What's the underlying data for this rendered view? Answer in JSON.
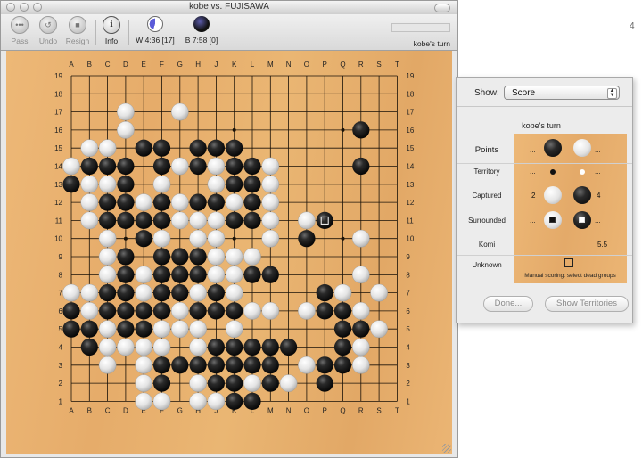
{
  "window": {
    "title": "kobe vs. FUJISAWA"
  },
  "toolbar": {
    "pass": "Pass",
    "undo": "Undo",
    "resign": "Resign",
    "info": "Info",
    "info_glyph": "i",
    "white_clock": "W 4:36 [17]",
    "black_clock": "B 7:58 [0]",
    "turn": "kobe's turn"
  },
  "board": {
    "size": 19,
    "columns": [
      "A",
      "B",
      "C",
      "D",
      "E",
      "F",
      "G",
      "H",
      "J",
      "K",
      "L",
      "M",
      "N",
      "O",
      "P",
      "Q",
      "R",
      "S",
      "T"
    ],
    "rows": [
      "19",
      "18",
      "17",
      "16",
      "15",
      "14",
      "13",
      "12",
      "11",
      "10",
      "9",
      "8",
      "7",
      "6",
      "5",
      "4",
      "3",
      "2",
      "1"
    ],
    "hoshi": [
      "D16",
      "K16",
      "Q16",
      "D10",
      "K10",
      "Q10",
      "D4",
      "K4",
      "Q4"
    ],
    "last_move": "P11",
    "black_stones": [
      "R16",
      "E15",
      "F15",
      "H15",
      "J15",
      "K15",
      "A13",
      "B14",
      "C14",
      "D14",
      "F14",
      "H14",
      "K14",
      "L14",
      "R14",
      "D13",
      "J13",
      "K13",
      "L13",
      "C12",
      "D12",
      "F12",
      "H12",
      "J12",
      "L12",
      "C11",
      "D11",
      "E11",
      "F11",
      "K11",
      "L11",
      "P11",
      "E10",
      "O10",
      "D9",
      "F9",
      "G9",
      "H9",
      "D8",
      "F8",
      "G8",
      "H8",
      "L8",
      "M8",
      "C7",
      "D7",
      "F7",
      "G7",
      "J7",
      "P7",
      "A6",
      "C6",
      "D6",
      "E6",
      "F6",
      "H6",
      "J6",
      "K6",
      "P6",
      "Q6",
      "A5",
      "B5",
      "C5",
      "D5",
      "E5",
      "Q5",
      "R5",
      "B4",
      "J4",
      "K4",
      "L4",
      "M4",
      "N4",
      "Q4",
      "F3",
      "G3",
      "H3",
      "J3",
      "K3",
      "L3",
      "M3",
      "P3",
      "Q3",
      "F2",
      "J2",
      "K2",
      "M2",
      "P2",
      "K1",
      "L1"
    ],
    "white_stones": [
      "D17",
      "G17",
      "D16",
      "B15",
      "C15",
      "A14",
      "G14",
      "J14",
      "M14",
      "B13",
      "C13",
      "F13",
      "J13",
      "M13",
      "B12",
      "E12",
      "G12",
      "K12",
      "M12",
      "B11",
      "G11",
      "H11",
      "J11",
      "M11",
      "O11",
      "C10",
      "F10",
      "H10",
      "J10",
      "M10",
      "R10",
      "C9",
      "J9",
      "K9",
      "L9",
      "C8",
      "E8",
      "J8",
      "K8",
      "R8",
      "A7",
      "B7",
      "E7",
      "H7",
      "K7",
      "Q7",
      "S7",
      "B6",
      "G6",
      "L6",
      "M6",
      "O6",
      "R6",
      "C5",
      "F5",
      "G5",
      "H5",
      "K5",
      "S5",
      "C4",
      "D4",
      "E4",
      "F4",
      "H4",
      "R4",
      "C3",
      "E3",
      "O3",
      "R3",
      "E2",
      "H2",
      "L2",
      "N2",
      "E1",
      "F1",
      "H1",
      "J1"
    ]
  },
  "score_panel": {
    "show_label": "Show:",
    "show_value": "Score",
    "turn": "kobe's turn",
    "points_label": "Points",
    "points_black": "...",
    "points_white": "...",
    "territory_label": "Territory",
    "territory_black": "...",
    "territory_white": "...",
    "captured_label": "Captured",
    "captured_white": "2",
    "captured_black": "4",
    "surrounded_label": "Surrounded",
    "surrounded_black": "...",
    "surrounded_white": "...",
    "komi_label": "Komi",
    "komi_value": "5.5",
    "unknown_label": "Unknown",
    "manual_note": "Manual scoring: select dead groups",
    "done_button": "Done...",
    "show_territories_button": "Show Territories"
  },
  "side": {
    "char": "4"
  }
}
